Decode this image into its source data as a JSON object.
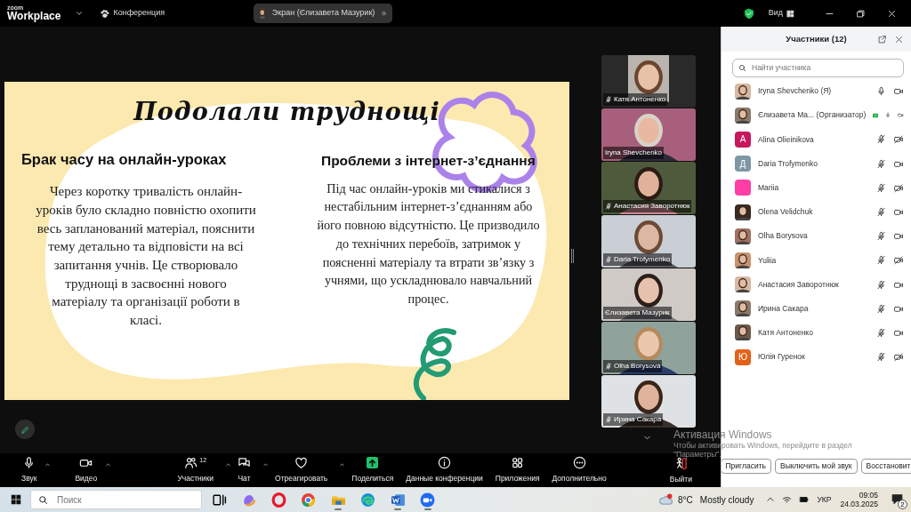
{
  "top_bar": {
    "logo_top": "zoom",
    "logo_bottom": "Workplace",
    "meeting_menu": "Конференция",
    "share_pill": "Экран (Єлизавета Мазурик)",
    "view_label": "Вид"
  },
  "slide": {
    "title": "Подолали труднощі",
    "columns": [
      {
        "heading": "Брак часу на онлайн-уроках",
        "body": "Через коротку тривалість онлайн-\nуроків було складно повністю охопити\nвесь запланований матеріал, пояснити\nтему детально та відповісти на всі\nзапитання учнів. Це створювало\nтруднощі в засвоєнні нового\nматеріалу та організації роботи в\nкласі."
      },
      {
        "heading": "Проблеми з інтернет-з’єднання",
        "body": "Під час онлайн-уроків ми стикалися з\nнестабільним інтернет-з’єднанням або\nйого повною відсутністю. Це призводило\nдо технічних перебоїв, затримок у\nпоясненні матеріалу та втрати зв’язку з\nучнями, що ускладнювало навчальний\nпроцес."
      }
    ]
  },
  "video_tiles": [
    {
      "name": "Катя Антоненко",
      "muted": true,
      "selected": false
    },
    {
      "name": "Iryna Shevchenko",
      "muted": false,
      "selected": false
    },
    {
      "name": "Анастасия Заворотнюк",
      "muted": true,
      "selected": false
    },
    {
      "name": "Daria Trofymenko",
      "muted": true,
      "selected": false
    },
    {
      "name": "Єлизавета Мазурик",
      "muted": false,
      "selected": true
    },
    {
      "name": "Olha Borysova",
      "muted": true,
      "selected": false
    },
    {
      "name": "Ирина Сакара",
      "muted": true,
      "selected": false
    }
  ],
  "participants_panel": {
    "title": "Участники (12)",
    "placeholder": "Найти участника",
    "participants": [
      {
        "name": "Iryna Shevchenko (Я)",
        "mic_muted": false,
        "video_off": false,
        "sharing": false
      },
      {
        "name": "Єлизавета Ма... (Организатор)",
        "mic_muted": false,
        "video_off": false,
        "sharing": true
      },
      {
        "name": "Alina Olieinikova",
        "kind": "letter",
        "letter": "A",
        "color": "#c8175d",
        "mic_muted": true,
        "video_off": true,
        "sharing": false
      },
      {
        "name": "Daria Trofymenko",
        "kind": "letter",
        "letter": "Д",
        "color": "#7d97a4",
        "mic_muted": true,
        "video_off": false,
        "sharing": false
      },
      {
        "name": "Mariia",
        "kind": "blank",
        "color": "#ff3fa6",
        "mic_muted": true,
        "video_off": true,
        "sharing": false
      },
      {
        "name": "Olena Velidchuk",
        "mic_muted": true,
        "video_off": false,
        "sharing": false
      },
      {
        "name": "Olha Borysova",
        "mic_muted": true,
        "video_off": false,
        "sharing": false
      },
      {
        "name": "Yuliia",
        "mic_muted": true,
        "video_off": true,
        "sharing": false
      },
      {
        "name": "Анастасия Заворотнюк",
        "mic_muted": true,
        "video_off": false,
        "sharing": false
      },
      {
        "name": "Ирина Сакара",
        "mic_muted": true,
        "video_off": false,
        "sharing": false
      },
      {
        "name": "Катя Антоненко",
        "mic_muted": true,
        "video_off": false,
        "sharing": false
      },
      {
        "name": "Юлія Гуренок",
        "kind": "letter",
        "letter": "Ю",
        "color": "#e0621b",
        "mic_muted": true,
        "video_off": true,
        "sharing": false
      }
    ],
    "buttons": [
      "Пригласить",
      "Выключить мой звук",
      "Восстановит"
    ]
  },
  "toolbar": {
    "items": [
      {
        "kind": "mic",
        "label": "Звук",
        "caret": true
      },
      {
        "kind": "video",
        "label": "Видео",
        "caret": true
      },
      {
        "kind": "participants",
        "label": "Участники",
        "count": "12",
        "caret": true
      },
      {
        "kind": "chat",
        "label": "Чат",
        "caret": true
      },
      {
        "kind": "react",
        "label": "Отреагировать",
        "caret": true
      },
      {
        "kind": "share",
        "label": "Поделиться",
        "caret": false
      },
      {
        "kind": "info",
        "label": "Данные конференции",
        "caret": false
      },
      {
        "kind": "apps",
        "label": "Приложения",
        "caret": false
      },
      {
        "kind": "more",
        "label": "Дополнительно",
        "caret": false
      },
      {
        "kind": "leave",
        "label": "Выйти",
        "caret": false
      }
    ]
  },
  "windows_notice": {
    "title": "Активация Windows",
    "lines": [
      "Чтобы активировать Windows, перейдите в раздел",
      "\"Параметры\"."
    ]
  },
  "taskbar": {
    "search_placeholder": "Поиск",
    "apps": [
      {
        "kind": "taskview",
        "open": false
      },
      {
        "kind": "copilot",
        "open": false
      },
      {
        "kind": "opera",
        "open": false
      },
      {
        "kind": "chrome",
        "open": false
      },
      {
        "kind": "folder",
        "open": true
      },
      {
        "kind": "edge",
        "open": false
      },
      {
        "kind": "word",
        "open": true
      },
      {
        "kind": "zoom",
        "open": true
      }
    ],
    "weather": {
      "temperature": "8°C",
      "condition": "Mostly cloudy"
    },
    "language": "УКР",
    "time": "09:05",
    "date": "24.03.2025",
    "notification_count": "2"
  }
}
